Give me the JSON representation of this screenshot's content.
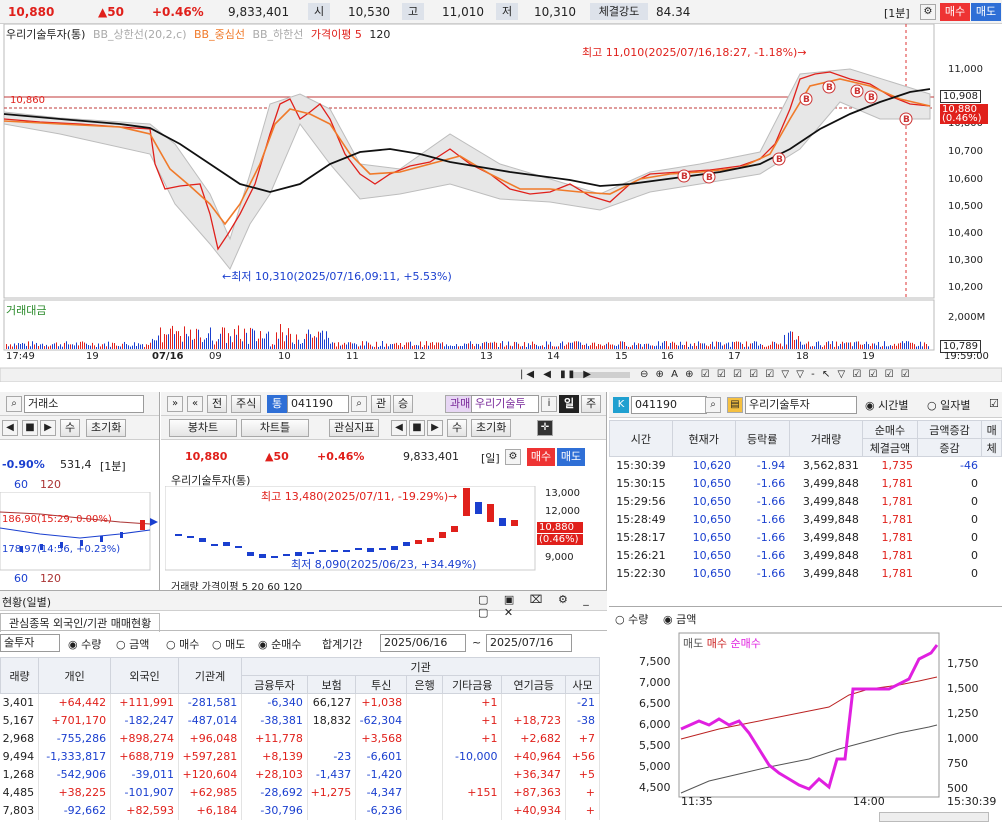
{
  "colors": {
    "up": "#e0201b",
    "down": "#1a3fcf",
    "panel_bg": "#f3f3f3",
    "accent": "#e33"
  },
  "top_quote": {
    "price": "10,880",
    "change": "▲50",
    "pct": "+0.46%",
    "volume": "9,833,401",
    "open_label": "시",
    "open": "10,530",
    "high_label": "고",
    "high": "11,010",
    "low_label": "저",
    "low": "10,310",
    "strength_label": "체결강도",
    "strength": "84.34",
    "interval": "[1분]",
    "buy": "매수",
    "sell": "매도"
  },
  "main_chart": {
    "legend": [
      "우리기술투자(통)",
      "BB_상한선(20,2,c)",
      "BB_중심선",
      "BB_하한선",
      "가격이평 5",
      "120"
    ],
    "high_note": "최고 11,010(2025/07/16,18:27, -1.18%)→",
    "low_note": "←최저 10,310(2025/07/16,09:11, +5.53%)",
    "ref_label": "10,860",
    "price_ticks": [
      "11,000",
      "10,900",
      "10,800",
      "10,700",
      "10,600",
      "10,500",
      "10,400",
      "10,300",
      "10,200"
    ],
    "price_box": "10,908",
    "price_box2": "10,880",
    "price_box3": "(0.46%)",
    "sub_title": "거래대금",
    "vol_tick": "2,000M",
    "vol_box": "10,789",
    "time_labels": [
      "17:49",
      "19",
      "07/16",
      "09",
      "10",
      "11",
      "12",
      "13",
      "14",
      "15",
      "16",
      "17",
      "18",
      "19",
      "19:59:00"
    ]
  },
  "mid_left": {
    "exch": "거래소",
    "prev": "수",
    "init": "초기화",
    "pct": "-0.90%",
    "val": "531,4",
    "interval": "[1분]",
    "leg1": "60",
    "leg2": "120",
    "note1": "186,90(15:29, 0.00%)",
    "note2": "178,97(14:56, +0.23%)",
    "leg3": "60",
    "leg4": "120"
  },
  "mid_center": {
    "tabs": [
      "전",
      "주식"
    ],
    "code_badge": "통",
    "code": "041190",
    "rel": "관",
    "seung": "승",
    "gwama": "과매",
    "name": "우리기술투",
    "info": "i",
    "day": "일",
    "ju": "주",
    "sub_tabs": [
      "봉차트",
      "차트틀",
      "관심지표"
    ],
    "prev": "수",
    "init": "초기화",
    "price": "10,880",
    "change": "▲50",
    "pct": "+0.46%",
    "volume": "9,833,401",
    "period": "[일]",
    "buy": "매수",
    "sell": "매도",
    "legend": "우리기술투자(통)",
    "high_note": "최고 13,480(2025/07/11, -19.29%)→",
    "low_note": "최저 8,090(2025/06/23, +34.49%)",
    "ticks": [
      "13,000",
      "12,000",
      "11,000",
      "10,000",
      "9,000"
    ],
    "box1": "10,880",
    "box2": "(0.46%)",
    "footer": "거래량  가격이평 5  20  60  120"
  },
  "right_top": {
    "code": "041190",
    "name": "우리기술투자",
    "opt1": "시간별",
    "opt2": "일자별",
    "headers": [
      "시간",
      "현재가",
      "등락률",
      "거래량",
      "순매수",
      "금액증감",
      "매"
    ],
    "sub_headers": [
      "체결금액",
      "증감",
      "체"
    ],
    "rows": [
      [
        "15:30:39",
        "10,620",
        "-1.94",
        "3,562,831",
        "1,735",
        "-46"
      ],
      [
        "15:30:15",
        "10,650",
        "-1.66",
        "3,499,848",
        "1,781",
        "0"
      ],
      [
        "15:29:56",
        "10,650",
        "-1.66",
        "3,499,848",
        "1,781",
        "0"
      ],
      [
        "15:28:49",
        "10,650",
        "-1.66",
        "3,499,848",
        "1,781",
        "0"
      ],
      [
        "15:28:17",
        "10,650",
        "-1.66",
        "3,499,848",
        "1,781",
        "0"
      ],
      [
        "15:26:21",
        "10,650",
        "-1.66",
        "3,499,848",
        "1,781",
        "0"
      ],
      [
        "15:22:30",
        "10,650",
        "-1.66",
        "3,499,848",
        "1,781",
        "0"
      ]
    ]
  },
  "right_bottom": {
    "opt1": "수량",
    "opt2": "금액",
    "legend": [
      "매도",
      "매수",
      "순매수"
    ],
    "left_ticks": [
      "7,500",
      "7,000",
      "6,500",
      "6,000",
      "5,500",
      "5,000",
      "4,500"
    ],
    "right_ticks": [
      "1,750",
      "1,500",
      "1,250",
      "1,000",
      "750",
      "500"
    ],
    "x_labels": [
      "11:35",
      "14:00",
      "15:30:39"
    ]
  },
  "bottom_left": {
    "title": "현황(일별)",
    "tabs": [
      "관심종목 외국인/기관 매매현황"
    ],
    "name": "술투자",
    "opt_qty": "수량",
    "opt_amt": "금액",
    "opt_buy": "매수",
    "opt_sell": "매도",
    "opt_net": "순매수",
    "period_label": "합계기간",
    "from": "2025/06/16",
    "to": "2025/07/16",
    "group_header": "기관",
    "headers": [
      "래량",
      "개인",
      "외국인",
      "기관계",
      "금융투자",
      "보험",
      "투신",
      "은행",
      "기타금융",
      "연기금등",
      "사모"
    ],
    "rows": [
      [
        "3,401",
        "+64,442",
        "+111,991",
        "-281,581",
        "-6,340",
        "66,127",
        "+1,038",
        "",
        "+1",
        "",
        "-21"
      ],
      [
        "5,167",
        "+701,170",
        "-182,247",
        "-487,014",
        "-38,381",
        "18,832",
        "-62,304",
        "",
        "+1",
        "+18,723",
        "-38"
      ],
      [
        "2,968",
        "-755,286",
        "+898,274",
        "+96,048",
        "+11,778",
        "",
        "+3,568",
        "",
        "+1",
        "+2,682",
        "+7"
      ],
      [
        "9,494",
        "-1,333,817",
        "+688,719",
        "+597,281",
        "+8,139",
        "-23",
        "-6,601",
        "",
        "-10,000",
        "+40,964",
        "+56"
      ],
      [
        "1,268",
        "-542,906",
        "-39,011",
        "+120,604",
        "+28,103",
        "-1,437",
        "-1,420",
        "",
        "",
        "+36,347",
        "+5"
      ],
      [
        "4,485",
        "+38,225",
        "-101,907",
        "+62,985",
        "-28,692",
        "+1,275",
        "-4,347",
        "",
        "+151",
        "+87,363",
        "+"
      ],
      [
        "7,803",
        "-92,662",
        "+82,593",
        "+6,184",
        "-30,796",
        "",
        "-6,236",
        "",
        "",
        "+40,934",
        "+"
      ]
    ]
  }
}
